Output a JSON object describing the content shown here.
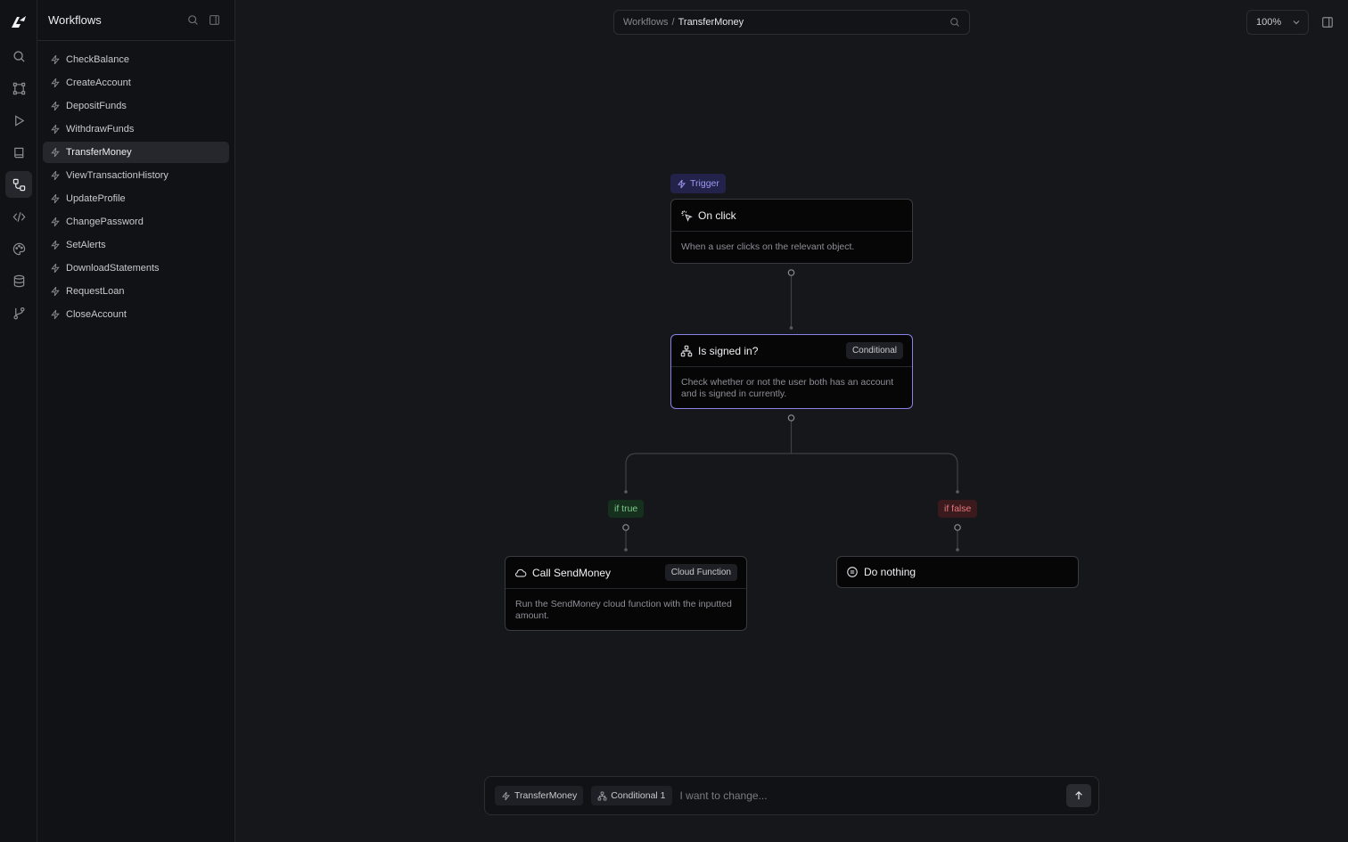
{
  "colors": {
    "accent": "#8a82e6",
    "true_branch": "#7fc98f",
    "false_branch": "#e5767d",
    "background": "#16171b"
  },
  "rail": {
    "icons": [
      "logo-icon",
      "search-icon",
      "components-icon",
      "play-icon",
      "book-icon",
      "workflows-icon",
      "code-icon",
      "palette-icon",
      "database-icon",
      "git-branch-icon"
    ],
    "active": "workflows-icon"
  },
  "sidebar": {
    "title": "Workflows",
    "items": [
      {
        "label": "CheckBalance"
      },
      {
        "label": "CreateAccount"
      },
      {
        "label": "DepositFunds"
      },
      {
        "label": "WithdrawFunds"
      },
      {
        "label": "TransferMoney",
        "active": true
      },
      {
        "label": "ViewTransactionHistory"
      },
      {
        "label": "UpdateProfile"
      },
      {
        "label": "ChangePassword"
      },
      {
        "label": "SetAlerts"
      },
      {
        "label": "DownloadStatements"
      },
      {
        "label": "RequestLoan"
      },
      {
        "label": "CloseAccount"
      }
    ]
  },
  "breadcrumb": {
    "parent": "Workflows",
    "separator": "/",
    "current": "TransferMoney"
  },
  "zoom": {
    "value": "100%"
  },
  "canvas": {
    "trigger_label": "Trigger",
    "nodes": {
      "on_click": {
        "title": "On click",
        "description": "When a user clicks on the relevant object."
      },
      "conditional": {
        "title": "Is signed in?",
        "tag": "Conditional",
        "description": "Check whether or not the user both has an account and is signed in currently."
      },
      "call": {
        "title": "Call SendMoney",
        "tag": "Cloud Function",
        "description": "Run the SendMoney cloud function with the inputted amount."
      },
      "nothing": {
        "title": "Do nothing"
      }
    },
    "branches": {
      "true_label": "if true",
      "false_label": "if false"
    }
  },
  "prompt": {
    "chips": [
      "TransferMoney",
      "Conditional 1"
    ],
    "placeholder": "I want to change..."
  }
}
